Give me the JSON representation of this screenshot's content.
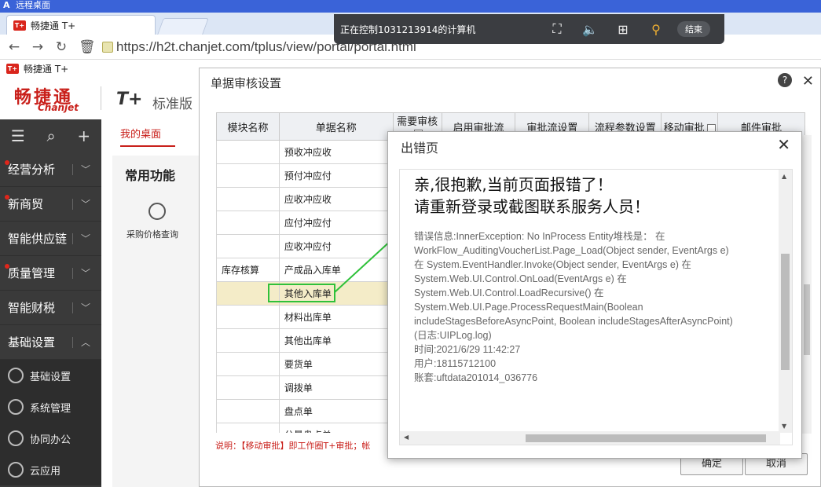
{
  "remote": {
    "app_title": "远程桌面",
    "toolbar_text": "正在控制1031213914的计算机",
    "end_label": "结束"
  },
  "browser": {
    "tab_title": "畅捷通 T+",
    "url": "https://h2t.chanjet.com/tplus/view/portal/portal.html",
    "bookmark": "畅捷通 T+",
    "tplus_icon_text": "T+"
  },
  "app": {
    "brand": "畅捷通",
    "brand_sub": "Chanjet",
    "product": "T+",
    "edition": "标准版"
  },
  "sidebar": {
    "items": [
      {
        "label": "经营分析",
        "dot": true,
        "arrow": "﹀"
      },
      {
        "label": "新商贸",
        "dot": true,
        "arrow": "﹀"
      },
      {
        "label": "智能供应链",
        "dot": false,
        "arrow": "﹀"
      },
      {
        "label": "质量管理",
        "dot": true,
        "arrow": "﹀"
      },
      {
        "label": "智能财税",
        "dot": false,
        "arrow": "﹀"
      },
      {
        "label": "基础设置",
        "dot": false,
        "arrow": "︿"
      }
    ],
    "subitems": [
      {
        "label": "基础设置"
      },
      {
        "label": "系统管理"
      },
      {
        "label": "协同办公"
      },
      {
        "label": "云应用"
      }
    ]
  },
  "desktop": {
    "tab": "我的桌面",
    "card_title": "常用功能",
    "shortcut": "采购价格查询"
  },
  "bg_dialog": {
    "title": "单据审核设置",
    "columns": [
      "模块名称",
      "单据名称",
      "需要审核",
      "启用审批流",
      "审批流设置",
      "流程参数设置",
      "移动审批",
      "邮件审批"
    ],
    "rows": [
      {
        "module": "",
        "doc": "预收冲应收"
      },
      {
        "module": "",
        "doc": "预付冲应付"
      },
      {
        "module": "",
        "doc": "应收冲应收"
      },
      {
        "module": "",
        "doc": "应付冲应付"
      },
      {
        "module": "",
        "doc": "应收冲应付"
      },
      {
        "module": "库存核算",
        "doc": "产成品入库单"
      },
      {
        "module": "",
        "doc": "其他入库单"
      },
      {
        "module": "",
        "doc": "材料出库单"
      },
      {
        "module": "",
        "doc": "其他出库单"
      },
      {
        "module": "",
        "doc": "要货单"
      },
      {
        "module": "",
        "doc": "调拨单"
      },
      {
        "module": "",
        "doc": "盘点单"
      },
      {
        "module": "",
        "doc": "分量盘点单"
      }
    ],
    "selected_row": 6,
    "note": "说明：【移动审批】即工作圈T+审批；帐",
    "ok": "确定",
    "cancel": "取消"
  },
  "error_dialog": {
    "title": "出错页",
    "headline1": "亲,很抱歉,当前页面报错了！",
    "headline2": "请重新登录或截图联系服务人员！",
    "detail_lines": [
      "错误信息:InnerException: No InProcess Entity堆栈是： 在",
      "WorkFlow_AuditingVoucherList.Page_Load(Object sender, EventArgs e)",
      "在 System.EventHandler.Invoke(Object sender, EventArgs e) 在",
      "System.Web.UI.Control.OnLoad(EventArgs e) 在",
      "System.Web.UI.Control.LoadRecursive() 在",
      "System.Web.UI.Page.ProcessRequestMain(Boolean",
      "includeStagesBeforeAsyncPoint, Boolean includeStagesAfterAsyncPoint)",
      "(日志:UIPLog.log)",
      "时间:2021/6/29 11:42:27",
      "用户:18115712100",
      "账套:uftdata201014_036776"
    ]
  },
  "colors": {
    "accent_red": "#c9201b",
    "sidebar_bg": "#3a3a3a",
    "highlight_green": "#2fc13a"
  }
}
